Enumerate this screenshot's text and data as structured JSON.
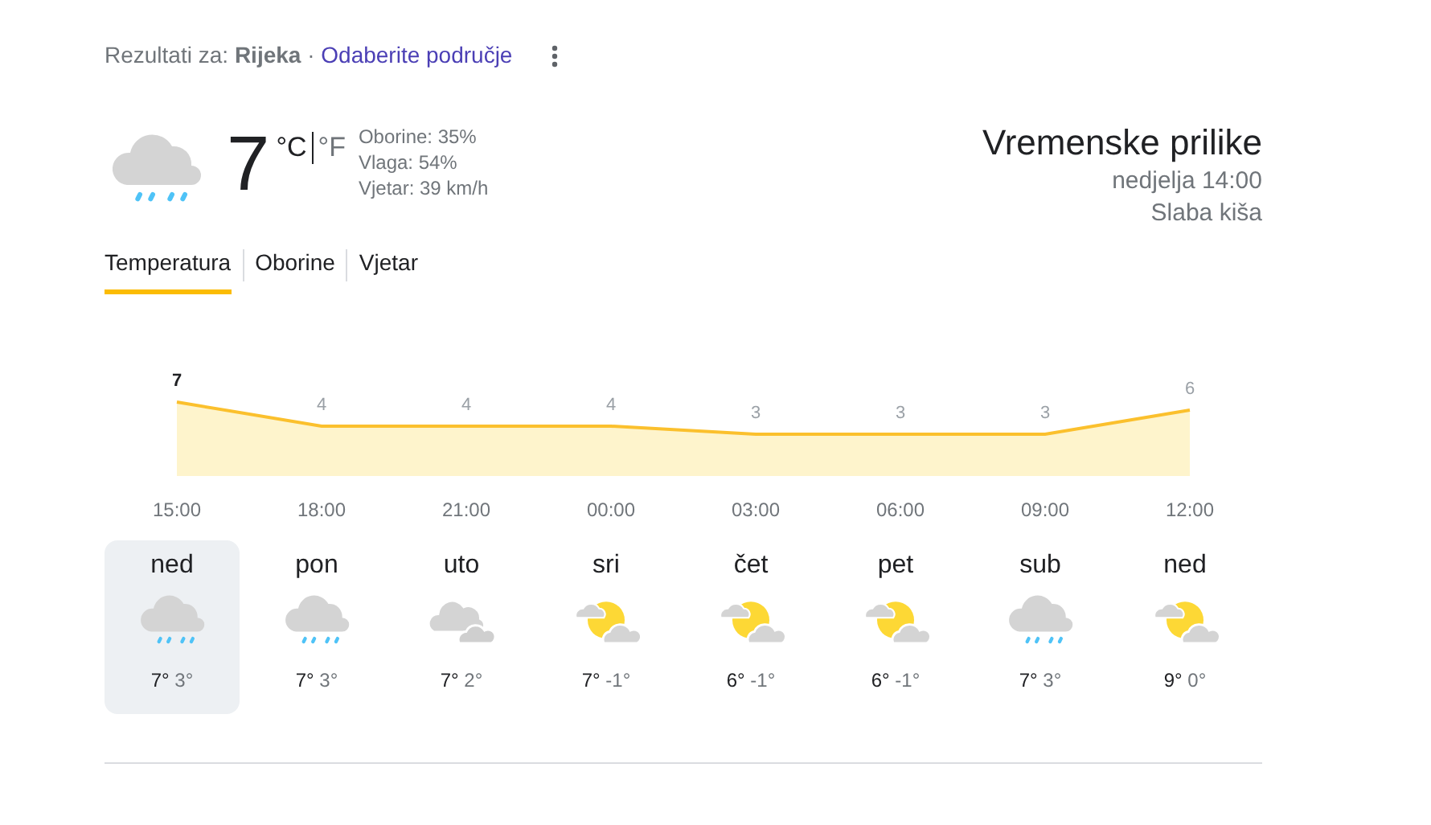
{
  "location_line": {
    "text": "Rezultati za: **Rijeka** ·",
    "link": "Odaberite područje"
  },
  "current": {
    "kind": "rain",
    "temperature": "7",
    "units": [
      {
        "label": "°C",
        "selected": true
      },
      {
        "label": "°F",
        "selected": false
      }
    ],
    "details": [
      "Oborine: 35%",
      "Vlaga: 54%",
      "Vjetar: 39 km/h"
    ]
  },
  "summary": {
    "title": "Vremenske prilike",
    "time": "nedjelja 14:00",
    "condition": "Slaba kiša"
  },
  "tabs": [
    {
      "label": "Temperatura",
      "selected": true
    },
    {
      "label": "Oborine",
      "selected": false
    },
    {
      "label": "Vjetar",
      "selected": false
    }
  ],
  "chart_data": {
    "type": "area",
    "categories": [
      "15:00",
      "18:00",
      "21:00",
      "00:00",
      "03:00",
      "06:00",
      "09:00",
      "12:00"
    ],
    "series": [
      {
        "color": "#fbc02d",
        "values": [
          7,
          4,
          4,
          4,
          3,
          3,
          3,
          6
        ]
      }
    ],
    "data_labels": true
  },
  "days": [
    {
      "label": "ned",
      "kind": "rain",
      "high": "7°",
      "low": "3°",
      "selected": true
    },
    {
      "label": "pon",
      "kind": "rain",
      "high": "7°",
      "low": "3°",
      "selected": false
    },
    {
      "label": "uto",
      "kind": "cloudy",
      "high": "7°",
      "low": "2°",
      "selected": false
    },
    {
      "label": "sri",
      "kind": "partly_cloudy",
      "high": "7°",
      "low": "-1°",
      "selected": false
    },
    {
      "label": "čet",
      "kind": "partly_cloudy",
      "high": "6°",
      "low": "-1°",
      "selected": false
    },
    {
      "label": "pet",
      "kind": "partly_cloudy",
      "high": "6°",
      "low": "-1°",
      "selected": false
    },
    {
      "label": "sub",
      "kind": "rain",
      "high": "7°",
      "low": "3°",
      "selected": false
    },
    {
      "label": "ned",
      "kind": "partly_cloudy",
      "high": "9°",
      "low": "0°",
      "selected": false
    }
  ]
}
